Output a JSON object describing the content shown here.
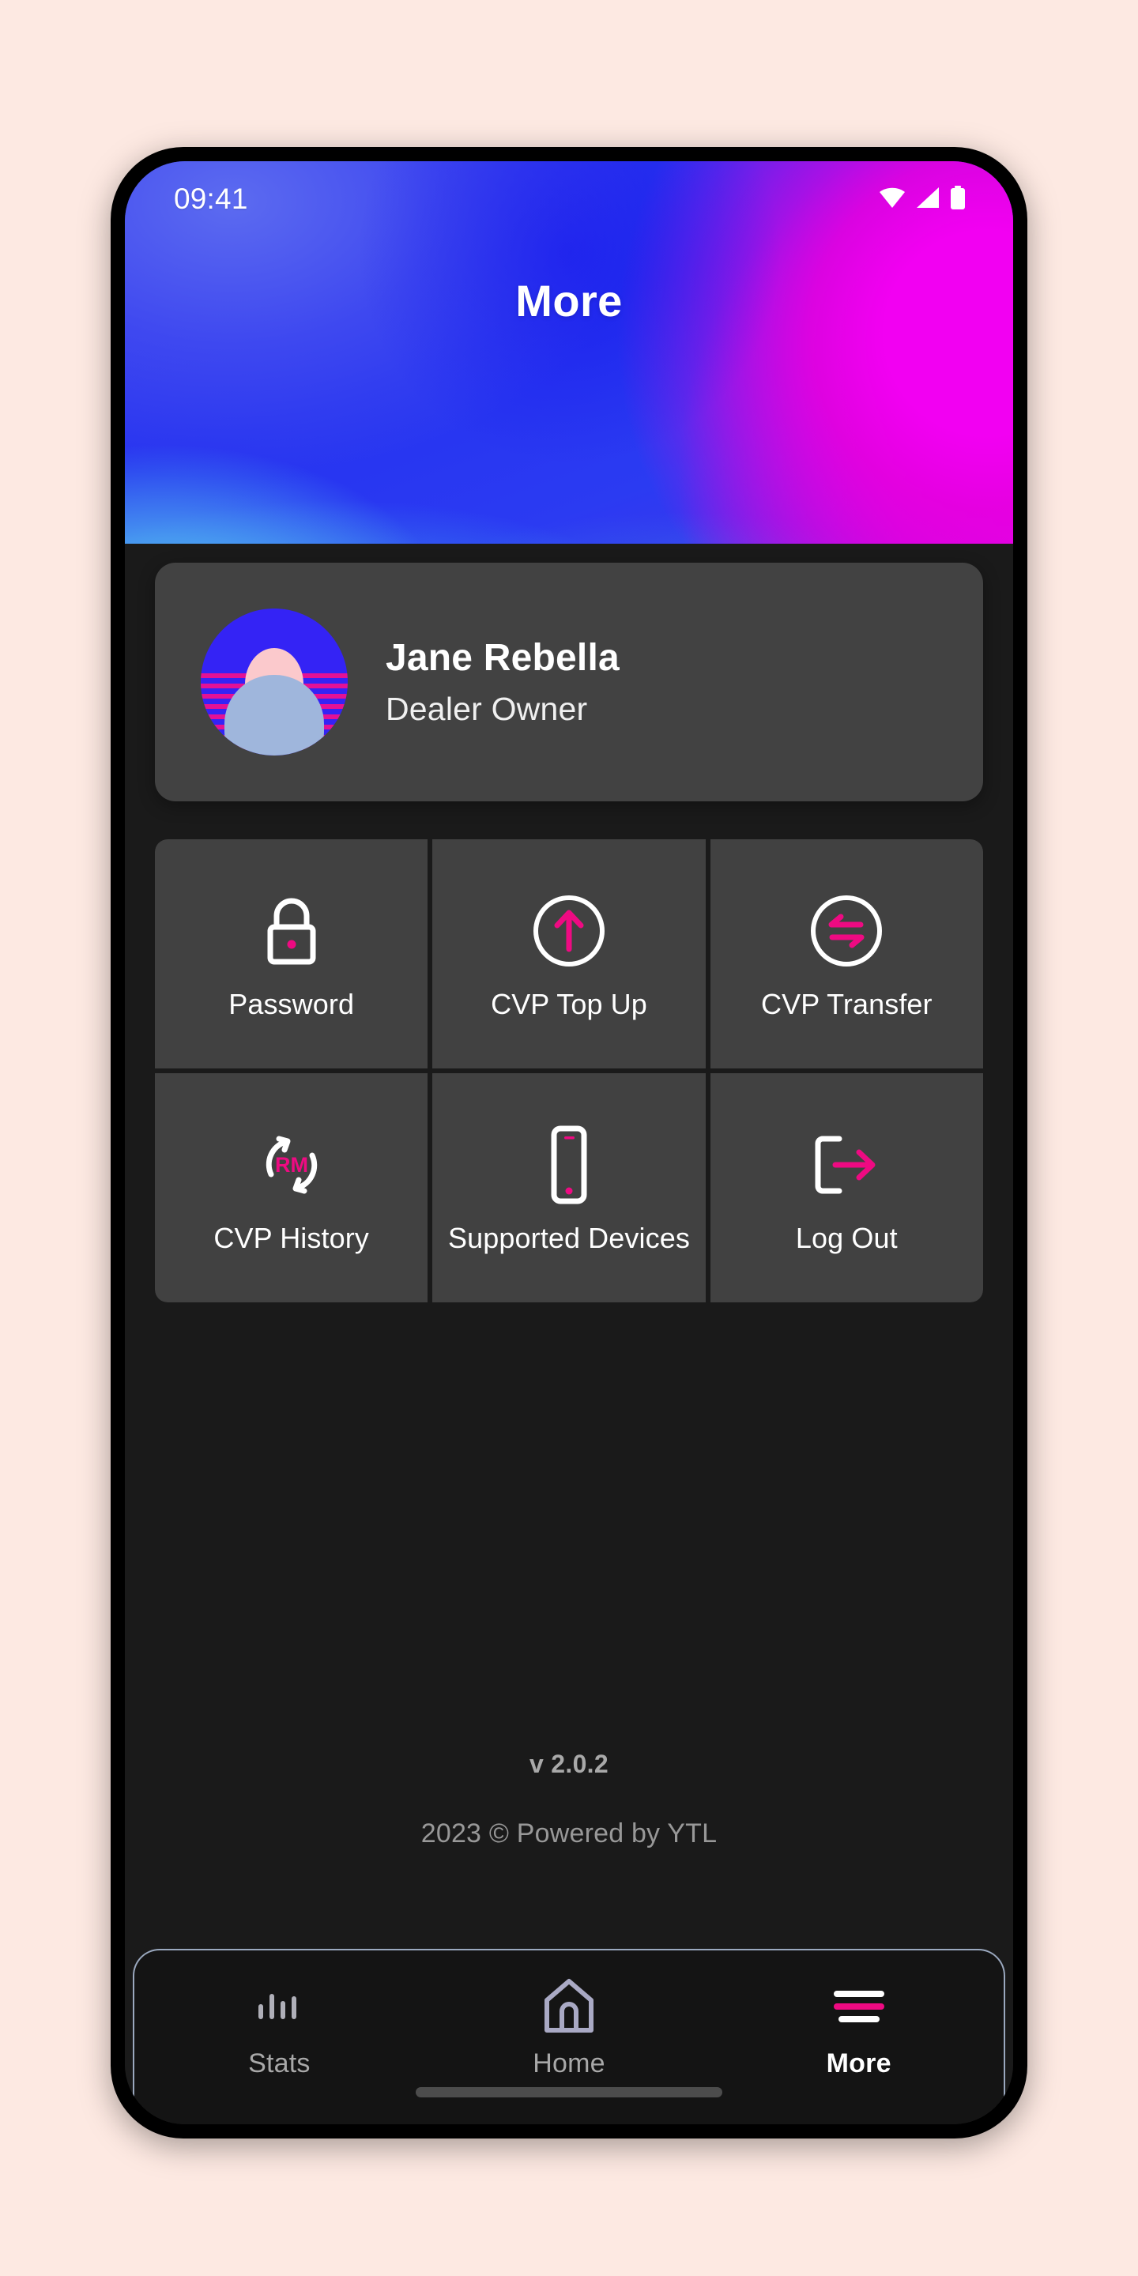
{
  "status_bar": {
    "time": "09:41",
    "icons": [
      "wifi-icon",
      "cellular-signal-icon",
      "battery-icon"
    ]
  },
  "header": {
    "title": "More"
  },
  "profile": {
    "name": "Jane Rebella",
    "role": "Dealer Owner",
    "avatar_name": "user-avatar"
  },
  "menu": {
    "items": [
      {
        "label": "Password",
        "icon": "lock-icon"
      },
      {
        "label": "CVP Top Up",
        "icon": "circle-arrow-up-icon"
      },
      {
        "label": "CVP Transfer",
        "icon": "circle-transfer-arrows-icon"
      },
      {
        "label": "CVP History",
        "icon": "refresh-rm-icon",
        "icon_text": "RM"
      },
      {
        "label": "Supported Devices",
        "icon": "mobile-phone-icon"
      },
      {
        "label": "Log Out",
        "icon": "logout-arrow-icon"
      }
    ]
  },
  "footer": {
    "version": "v 2.0.2",
    "copyright": "2023 © Powered by YTL"
  },
  "bottom_nav": {
    "items": [
      {
        "label": "Stats",
        "icon": "bar-chart-icon",
        "active": false
      },
      {
        "label": "Home",
        "icon": "home-icon",
        "active": false
      },
      {
        "label": "More",
        "icon": "hamburger-icon",
        "active": true
      }
    ]
  },
  "colors": {
    "accent_pink": "#EE0A82",
    "magenta": "#EE00EE",
    "blue": "#2633F0",
    "card_bg": "#424242",
    "page_bg": "#1A1A1A",
    "canvas_bg": "#FDE9E2"
  }
}
